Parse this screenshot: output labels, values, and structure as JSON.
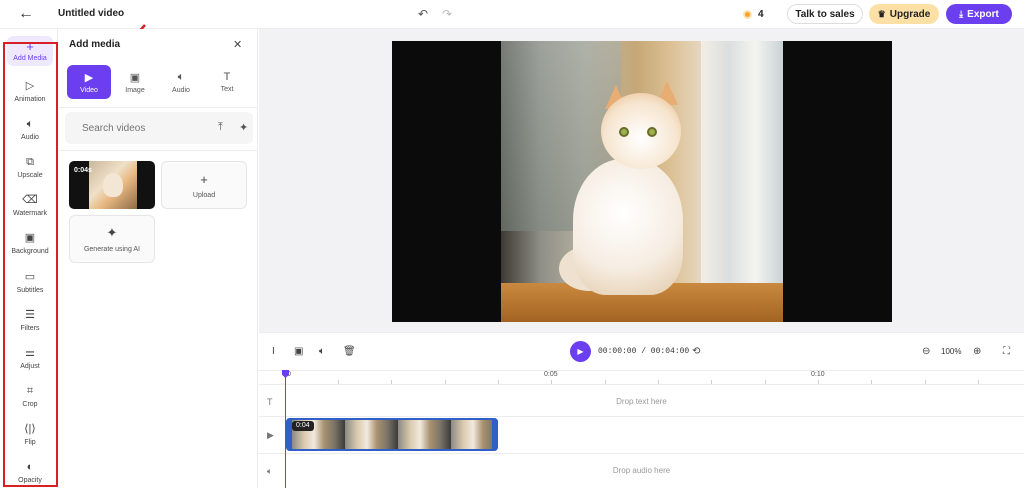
{
  "topbar": {
    "title": "Untitled video",
    "credits": "4",
    "talk_to_sales": "Talk to sales",
    "upgrade": "Upgrade",
    "export": "Export"
  },
  "rail": {
    "add_media": "Add Media",
    "items": [
      {
        "label": "Animation",
        "icon": "play-outline-icon"
      },
      {
        "label": "Audio",
        "icon": "speaker-icon"
      },
      {
        "label": "Upscale",
        "icon": "upscale-icon"
      },
      {
        "label": "Watermark",
        "icon": "eraser-icon"
      },
      {
        "label": "Background",
        "icon": "image-icon"
      },
      {
        "label": "Subtitles",
        "icon": "subtitles-icon"
      },
      {
        "label": "Filters",
        "icon": "filter-icon"
      },
      {
        "label": "Adjust",
        "icon": "sliders-icon"
      },
      {
        "label": "Crop",
        "icon": "crop-icon"
      },
      {
        "label": "Flip",
        "icon": "flip-icon"
      },
      {
        "label": "Opacity",
        "icon": "opacity-icon"
      }
    ]
  },
  "panel": {
    "title": "Add media",
    "tabs": [
      "Video",
      "Image",
      "Audio",
      "Text"
    ],
    "active_tab": "Video",
    "search_placeholder": "Search videos",
    "thumbnail_duration": "0:04s",
    "upload_label": "Upload",
    "generate_label": "Generate using AI"
  },
  "timeline": {
    "time": "00:00:00 / 00:04:00",
    "zoom": "100%",
    "ruler_labels": [
      "0",
      "0:05",
      "0:10"
    ],
    "text_track_drop": "Drop text here",
    "audio_track_drop": "Drop audio here",
    "clip_duration": "0:04"
  },
  "colors": {
    "accent": "#6b3ef0",
    "annotation": "#d61f26",
    "upgrade": "#fde0a6",
    "clip": "#2f5fc7"
  }
}
